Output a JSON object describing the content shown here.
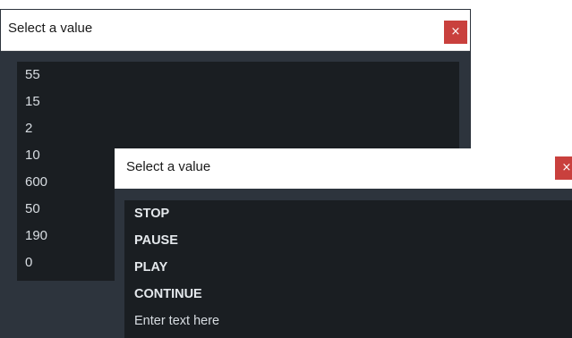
{
  "dialog_numbers": {
    "title": "Select a value",
    "close_label": "×",
    "items": [
      "55",
      "15",
      "2",
      "10",
      "600",
      "50",
      "190",
      "0"
    ]
  },
  "dialog_commands": {
    "title": "Select a value",
    "close_label": "×",
    "items": [
      "STOP",
      "PAUSE",
      "PLAY",
      "CONTINUE"
    ],
    "input_placeholder": "Enter text here"
  },
  "colors": {
    "dialog_bg": "#2d343d",
    "list_bg": "#1a1e22",
    "close_button": "#c9403d",
    "list_text": "#d8dde2"
  },
  "icons": {
    "close": "close-icon"
  }
}
